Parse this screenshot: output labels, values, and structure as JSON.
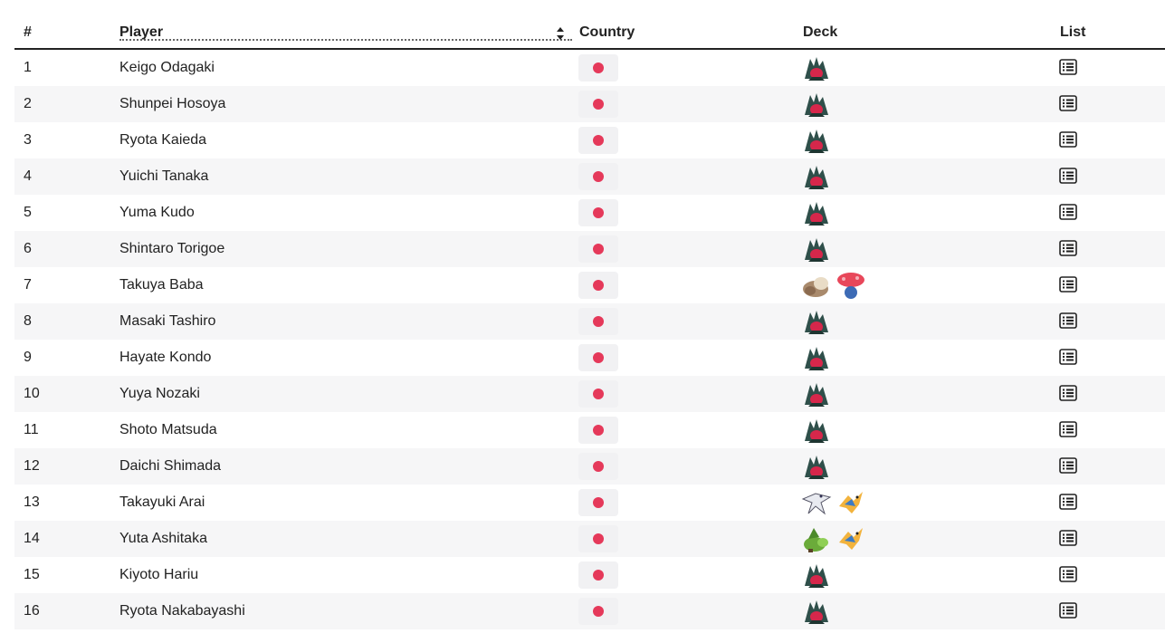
{
  "headers": {
    "rank": "#",
    "player": "Player",
    "country": "Country",
    "deck": "Deck",
    "list": "List"
  },
  "colors": {
    "flag_dot": "#e5395a",
    "alt_row": "#f6f6f7"
  },
  "rows": [
    {
      "rank": "1",
      "player": "Keigo Odagaki",
      "deck": [
        "roaring-moon-icon"
      ]
    },
    {
      "rank": "2",
      "player": "Shunpei Hosoya",
      "deck": [
        "roaring-moon-icon"
      ]
    },
    {
      "rank": "3",
      "player": "Ryota Kaieda",
      "deck": [
        "roaring-moon-icon"
      ]
    },
    {
      "rank": "4",
      "player": "Yuichi Tanaka",
      "deck": [
        "roaring-moon-icon"
      ]
    },
    {
      "rank": "5",
      "player": "Yuma Kudo",
      "deck": [
        "roaring-moon-icon"
      ]
    },
    {
      "rank": "6",
      "player": "Shintaro Torigoe",
      "deck": [
        "roaring-moon-icon"
      ]
    },
    {
      "rank": "7",
      "player": "Takuya Baba",
      "deck": [
        "slaking-icon",
        "vileplume-icon"
      ]
    },
    {
      "rank": "8",
      "player": "Masaki Tashiro",
      "deck": [
        "roaring-moon-icon"
      ]
    },
    {
      "rank": "9",
      "player": "Hayate Kondo",
      "deck": [
        "roaring-moon-icon"
      ]
    },
    {
      "rank": "10",
      "player": "Yuya Nozaki",
      "deck": [
        "roaring-moon-icon"
      ]
    },
    {
      "rank": "11",
      "player": "Shoto Matsuda",
      "deck": [
        "roaring-moon-icon"
      ]
    },
    {
      "rank": "12",
      "player": "Daichi Shimada",
      "deck": [
        "roaring-moon-icon"
      ]
    },
    {
      "rank": "13",
      "player": "Takayuki Arai",
      "deck": [
        "lugia-icon",
        "archeops-icon"
      ]
    },
    {
      "rank": "14",
      "player": "Yuta Ashitaka",
      "deck": [
        "grotle-icon",
        "archeops-icon"
      ]
    },
    {
      "rank": "15",
      "player": "Kiyoto Hariu",
      "deck": [
        "roaring-moon-icon"
      ]
    },
    {
      "rank": "16",
      "player": "Ryota Nakabayashi",
      "deck": [
        "roaring-moon-icon"
      ]
    }
  ]
}
